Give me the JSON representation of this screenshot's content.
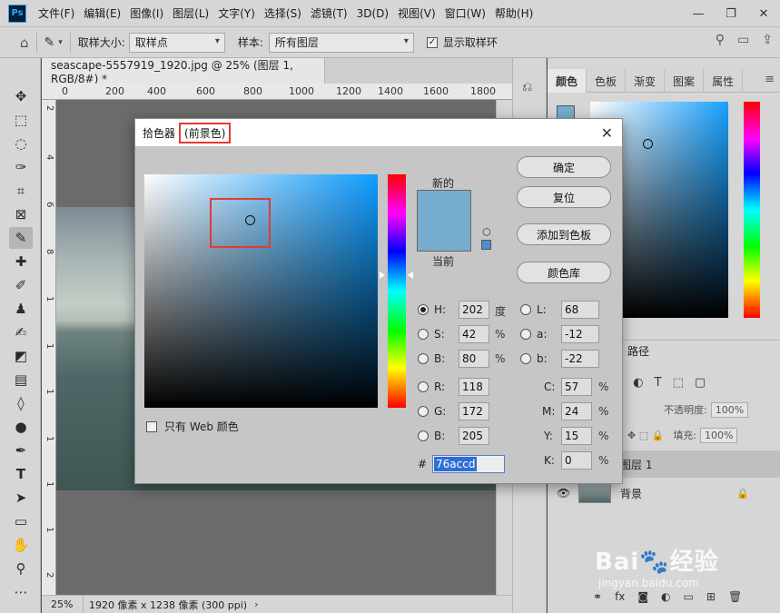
{
  "menubar": {
    "logo": "Ps",
    "items": [
      "文件(F)",
      "编辑(E)",
      "图像(I)",
      "图层(L)",
      "文字(Y)",
      "选择(S)",
      "滤镜(T)",
      "3D(D)",
      "视图(V)",
      "窗口(W)",
      "帮助(H)"
    ]
  },
  "options": {
    "sample_size_label": "取样大小:",
    "sample_size_value": "取样点",
    "sample_label": "样本:",
    "sample_value": "所有图层",
    "show_ring_label": "显示取样环"
  },
  "document": {
    "tab_title": "seascape-5557919_1920.jpg @ 25% (图层 1, RGB/8#) *",
    "ruler_h": [
      "0",
      "200",
      "400",
      "600",
      "800",
      "1000",
      "1200",
      "1400",
      "1600",
      "1800"
    ],
    "ruler_v": [
      "2",
      "4",
      "6",
      "8",
      "1",
      "1",
      "1",
      "1",
      "1",
      "1",
      "2"
    ],
    "zoom": "25%",
    "info": "1920 像素 x 1238 像素 (300 ppi)"
  },
  "right_panel": {
    "tabs": [
      "颜色",
      "色板",
      "渐变",
      "图案",
      "属性"
    ],
    "layers_tab": "路径",
    "opacity_label": "不透明度:",
    "opacity_value": "100%",
    "fill_label": "填充:",
    "fill_value": "100%",
    "layers": [
      {
        "name": "图层 1",
        "selected": true
      },
      {
        "name": "背景",
        "selected": false
      }
    ]
  },
  "dialog": {
    "title": "拾色器",
    "subtitle": "(前景色)",
    "new_label": "新的",
    "current_label": "当前",
    "web_only_label": "只有 Web 颜色",
    "buttons": {
      "ok": "确定",
      "reset": "复位",
      "add_swatch": "添加到色板",
      "libraries": "颜色库"
    },
    "hsb": {
      "H": "202",
      "S": "42",
      "B": "80",
      "h_unit": "度",
      "pct": "%"
    },
    "rgb": {
      "R": "118",
      "G": "172",
      "B": "205"
    },
    "lab": {
      "L": "68",
      "a": "-12",
      "b": "-22"
    },
    "cmyk": {
      "C": "57",
      "M": "24",
      "Y": "15",
      "K": "0"
    },
    "hex_label": "#",
    "hex": "76accd",
    "color": "#76accd"
  },
  "watermark": {
    "brand": "Bai🐾经验",
    "url": "jingyan.baidu.com"
  }
}
